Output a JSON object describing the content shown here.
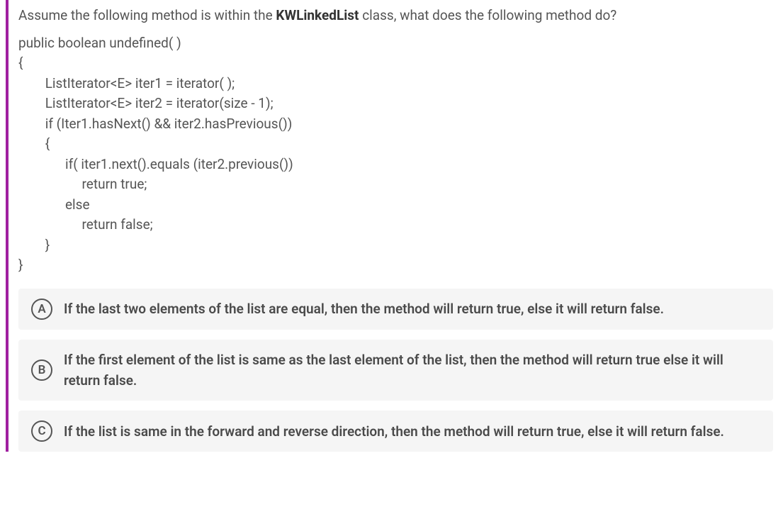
{
  "question": {
    "intro_before": "Assume the following method is within the ",
    "bold_class": "KWLinkedList",
    "intro_after": " class, what does the following method do?",
    "code_lines": [
      "public boolean undefined( )",
      "{",
      "        ListIterator<E> iter1 = iterator( );",
      "        ListIterator<E> iter2 = iterator(size - 1);",
      "        if (Iter1.hasNext() && iter2.hasPrevious())",
      "        {",
      "              if( iter1.next().equals (iter2.previous())",
      "                   return true;",
      "              else",
      "                   return false;",
      "        }",
      "}"
    ]
  },
  "options": [
    {
      "letter": "A",
      "text": "If the last two elements of the list are equal, then the method will return true, else it will return false."
    },
    {
      "letter": "B",
      "text": "If the first element of the list is same as the last element of the list, then the method will return true else it will return false."
    },
    {
      "letter": "C",
      "text": "If the list is same in the forward and reverse direction, then the method will return true, else it will return false."
    }
  ]
}
